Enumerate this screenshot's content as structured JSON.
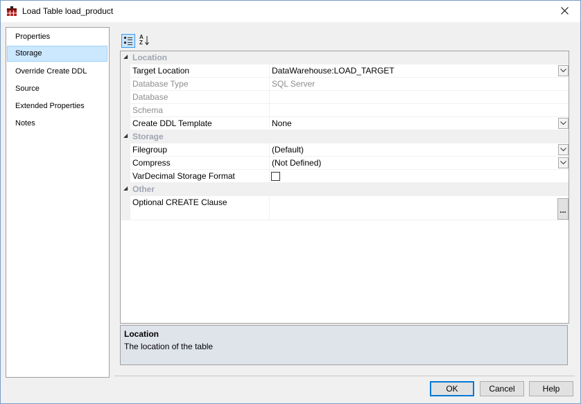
{
  "window": {
    "title": "Load Table load_product",
    "icon": "table-icon",
    "close_icon": "close-icon"
  },
  "nav": {
    "items": [
      {
        "label": "Properties"
      },
      {
        "label": "Storage",
        "selected": true
      },
      {
        "label": "Override Create DDL"
      },
      {
        "label": "Source"
      },
      {
        "label": "Extended Properties"
      },
      {
        "label": "Notes"
      }
    ]
  },
  "toolbar": {
    "categorized_icon": "categorized-view-icon",
    "alphabetical_icon": "sort-alphabetical-icon",
    "alphabetical_glyph_top": "A",
    "alphabetical_glyph_bottom": "Z"
  },
  "grid": {
    "categories": {
      "location": "Location",
      "storage": "Storage",
      "other": "Other"
    },
    "rows": {
      "target_location": {
        "name": "Target Location",
        "value": "DataWarehouse:LOAD_TARGET"
      },
      "database_type": {
        "name": "Database Type",
        "value": "SQL Server"
      },
      "database": {
        "name": "Database",
        "value": ""
      },
      "schema": {
        "name": "Schema",
        "value": ""
      },
      "create_ddl_template": {
        "name": "Create DDL Template",
        "value": "None"
      },
      "filegroup": {
        "name": "Filegroup",
        "value": "(Default)"
      },
      "compress": {
        "name": "Compress",
        "value": "(Not Defined)"
      },
      "vardecimal": {
        "name": "VarDecimal Storage Format",
        "checked": false
      },
      "optional_create": {
        "name": "Optional CREATE Clause",
        "value": "",
        "button": "..."
      }
    }
  },
  "description": {
    "title": "Location",
    "text": "The location of the table"
  },
  "buttons": {
    "ok": "OK",
    "cancel": "Cancel",
    "help": "Help"
  },
  "colors": {
    "selection": "#cce8ff",
    "default_button_border": "#0078d7",
    "category_text": "#a0a6b3"
  }
}
